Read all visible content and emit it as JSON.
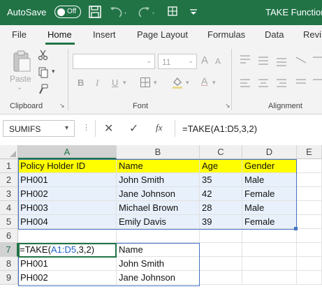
{
  "titlebar": {
    "autosave_label": "AutoSave",
    "autosave_state": "Off",
    "title": "TAKE Function",
    "bg_color": "#217346"
  },
  "tabs": [
    "File",
    "Home",
    "Insert",
    "Page Layout",
    "Formulas",
    "Data",
    "Revi"
  ],
  "active_tab": "Home",
  "ribbon": {
    "clipboard": {
      "label": "Clipboard",
      "paste_label": "Paste"
    },
    "font": {
      "label": "Font",
      "font_size": "11",
      "bold": "B",
      "italic": "I",
      "underline": "U"
    },
    "alignment": {
      "label": "Alignment"
    }
  },
  "formula_bar": {
    "name_box": "SUMIFS",
    "fx": "fx",
    "formula": "=TAKE(A1:D5,3,2)"
  },
  "columns": [
    "A",
    "B",
    "C",
    "D",
    "E"
  ],
  "rows": [
    "1",
    "2",
    "3",
    "4",
    "5",
    "6",
    "7",
    "8",
    "9"
  ],
  "table": {
    "header": [
      "Policy Holder ID",
      "Name",
      "Age",
      "Gender"
    ],
    "rows": [
      [
        "PH001",
        "John Smith",
        "35",
        "Male"
      ],
      [
        "PH002",
        "Jane Johnson",
        "42",
        "Female"
      ],
      [
        "PH003",
        "Michael Brown",
        "28",
        "Male"
      ],
      [
        "PH004",
        "Emily Davis",
        "39",
        "Female"
      ]
    ]
  },
  "result": {
    "formula_prefix": "=TAKE(",
    "formula_ref": "A1:D5",
    "formula_suffix": ",3,2)",
    "b7": "Name",
    "rows": [
      [
        "PH001",
        "John Smith"
      ],
      [
        "PH002",
        "Jane Johnson"
      ]
    ]
  },
  "colors": {
    "header_fill": "#ffff00",
    "range_fill": "#e8f0fb",
    "range_border": "#4472c4",
    "accent": "#217346"
  }
}
